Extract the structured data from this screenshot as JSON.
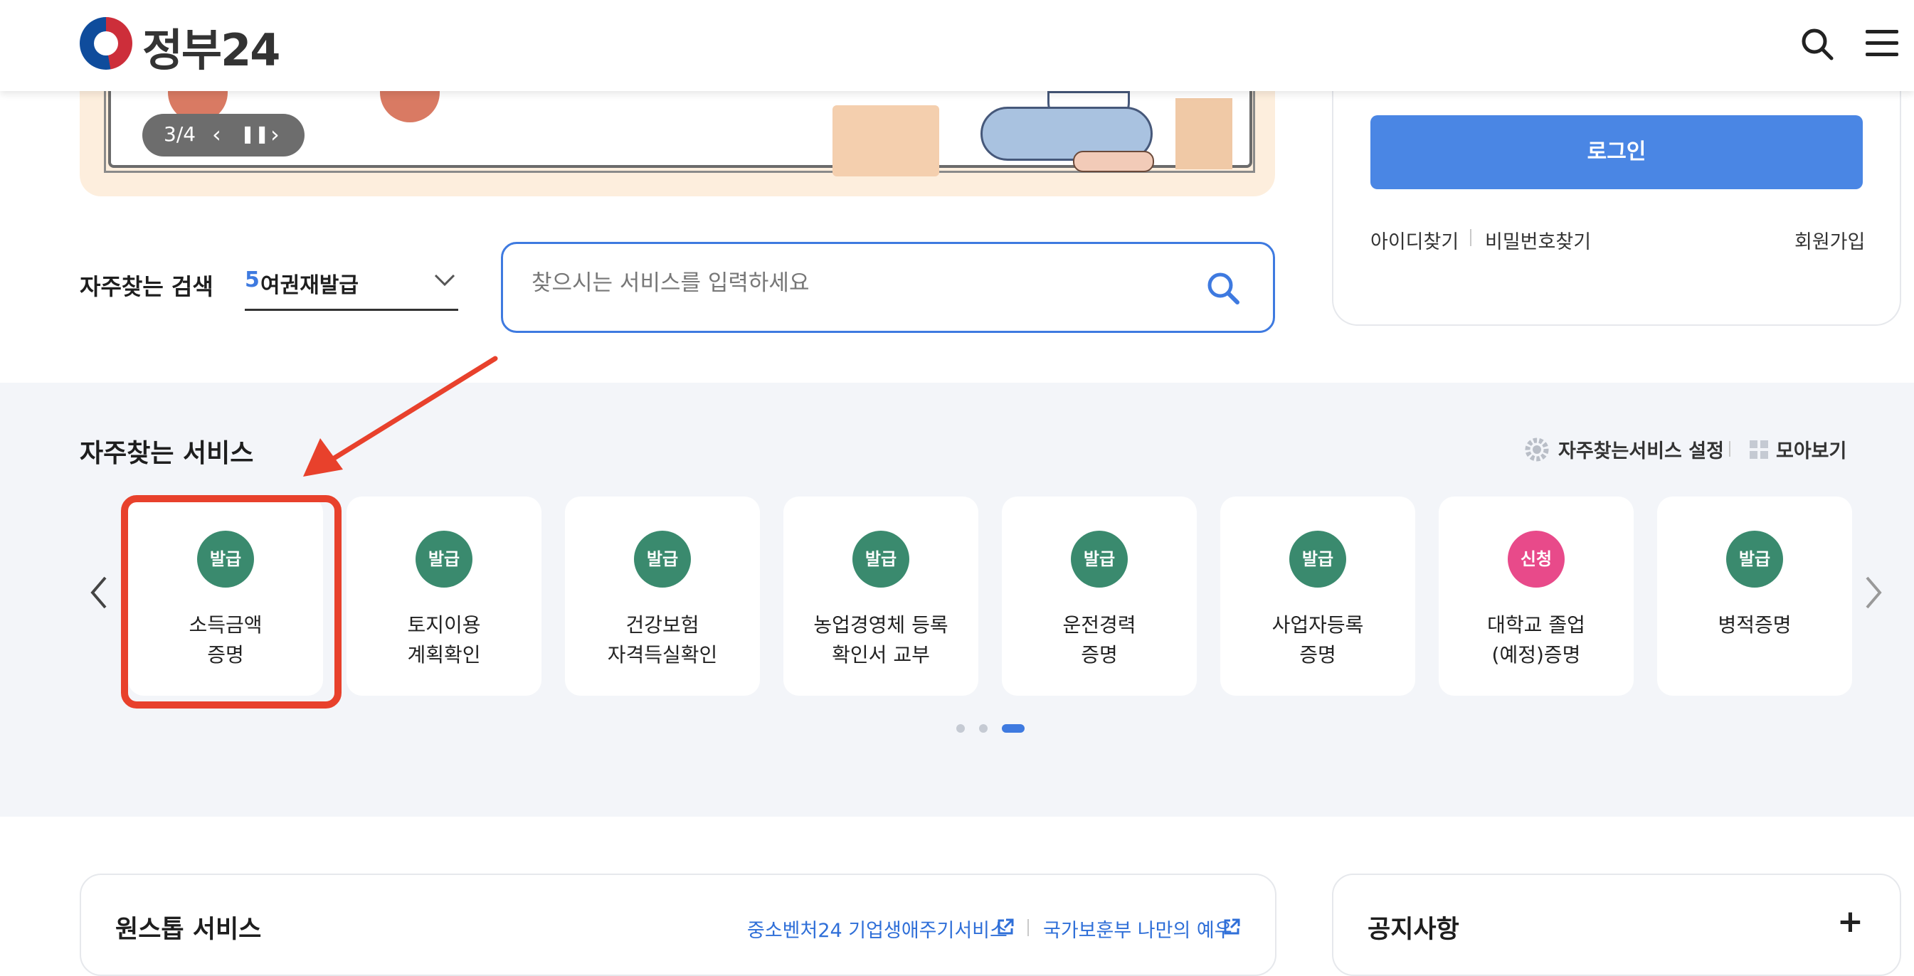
{
  "header": {
    "logo_text": "정부24",
    "icons": [
      "search-icon",
      "hamburger-menu-icon"
    ]
  },
  "banner": {
    "pager": {
      "text": "3/4",
      "icons": [
        "chevron-left-icon",
        "pause-icon",
        "chevron-right-icon"
      ]
    }
  },
  "quick_search": {
    "label": "자주찾는 검색",
    "selected_rank": "5",
    "selected_text": "여권재발급",
    "search_placeholder": "찾으시는 서비스를 입력하세요"
  },
  "login": {
    "button_label": "로그인",
    "find_id": "아이디찾기",
    "find_password": "비밀번호찾기",
    "signup": "회원가입"
  },
  "favorites": {
    "title": "자주찾는 서비스",
    "settings_label": "자주찾는서비스 설정",
    "view_all_label": "모아보기",
    "items": [
      {
        "badge": "발급",
        "badge_color": "#3a8a6e",
        "name": "소득금액\n증명"
      },
      {
        "badge": "발급",
        "badge_color": "#3a8a6e",
        "name": "토지이용\n계획확인"
      },
      {
        "badge": "발급",
        "badge_color": "#3a8a6e",
        "name": "건강보험\n자격득실확인"
      },
      {
        "badge": "발급",
        "badge_color": "#3a8a6e",
        "name": "농업경영체 등록\n확인서 교부"
      },
      {
        "badge": "발급",
        "badge_color": "#3a8a6e",
        "name": "운전경력\n증명"
      },
      {
        "badge": "발급",
        "badge_color": "#3a8a6e",
        "name": "사업자등록\n증명"
      },
      {
        "badge": "신청",
        "badge_color": "#e84a8a",
        "name": "대학교 졸업\n(예정)증명"
      },
      {
        "badge": "발급",
        "badge_color": "#3a8a6e",
        "name": "병적증명"
      }
    ],
    "page_dots": 3,
    "active_dot": 3
  },
  "onestop": {
    "title": "원스톱 서비스",
    "links": [
      "중소벤처24 기업생애주기서비스",
      "국가보훈부 나만의 예우"
    ]
  },
  "notice": {
    "title": "공지사항",
    "more": "+"
  },
  "colors": {
    "accent_blue": "#3e7ae0",
    "login_blue": "#4a86e4",
    "issue_green": "#3a8a6e",
    "apply_pink": "#e84a8a",
    "highlight_red": "#e8412c",
    "band_bg": "#f3f5f9"
  }
}
